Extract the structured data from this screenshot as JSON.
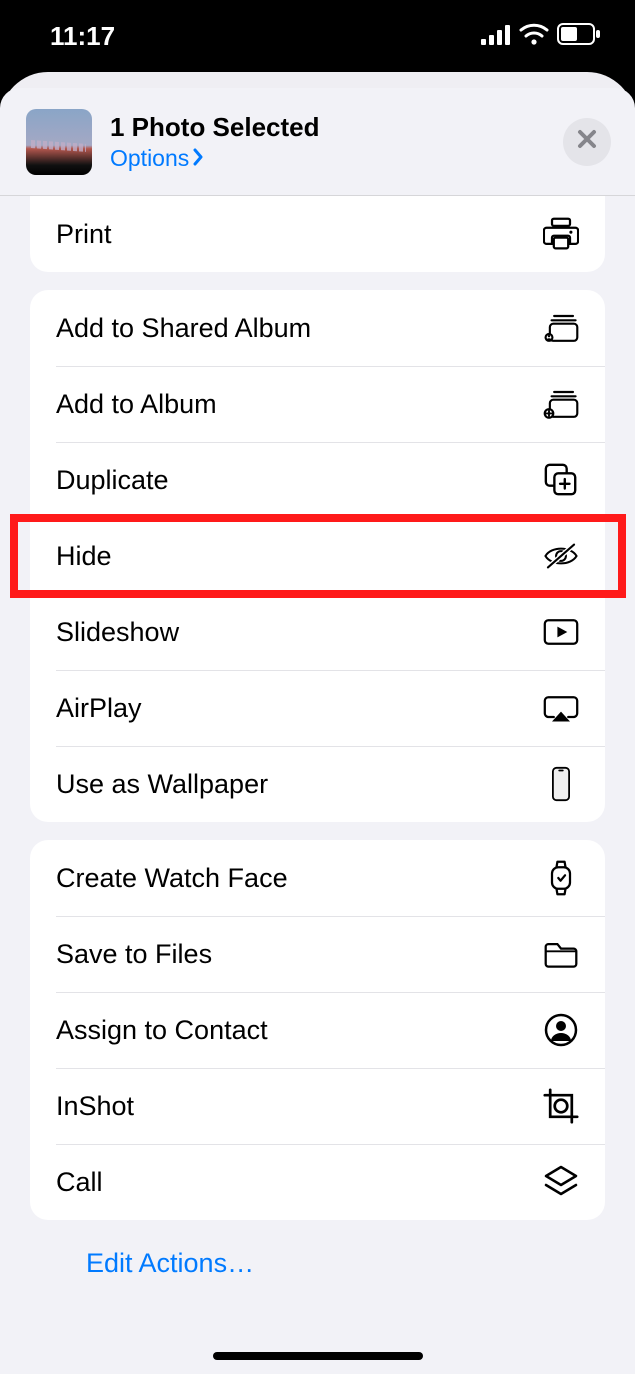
{
  "status": {
    "time": "11:17"
  },
  "header": {
    "title": "1 Photo Selected",
    "options_label": "Options"
  },
  "groups": [
    {
      "rows": [
        {
          "label": "Print",
          "icon": "printer-icon",
          "name": "action-print"
        }
      ]
    },
    {
      "rows": [
        {
          "label": "Add to Shared Album",
          "icon": "shared-album-icon",
          "name": "action-add-shared-album"
        },
        {
          "label": "Add to Album",
          "icon": "add-album-icon",
          "name": "action-add-album"
        },
        {
          "label": "Duplicate",
          "icon": "duplicate-icon",
          "name": "action-duplicate"
        },
        {
          "label": "Hide",
          "icon": "eye-slash-icon",
          "name": "action-hide",
          "highlight": true
        },
        {
          "label": "Slideshow",
          "icon": "play-rect-icon",
          "name": "action-slideshow"
        },
        {
          "label": "AirPlay",
          "icon": "airplay-icon",
          "name": "action-airplay"
        },
        {
          "label": "Use as Wallpaper",
          "icon": "phone-outline-icon",
          "name": "action-wallpaper"
        }
      ]
    },
    {
      "rows": [
        {
          "label": "Create Watch Face",
          "icon": "watch-icon",
          "name": "action-watch-face"
        },
        {
          "label": "Save to Files",
          "icon": "folder-icon",
          "name": "action-save-files"
        },
        {
          "label": "Assign to Contact",
          "icon": "contact-icon",
          "name": "action-assign-contact"
        },
        {
          "label": "InShot",
          "icon": "inshot-icon",
          "name": "action-inshot"
        },
        {
          "label": "Call",
          "icon": "layers-icon",
          "name": "action-call"
        }
      ]
    }
  ],
  "footer": {
    "edit_actions": "Edit Actions…"
  }
}
